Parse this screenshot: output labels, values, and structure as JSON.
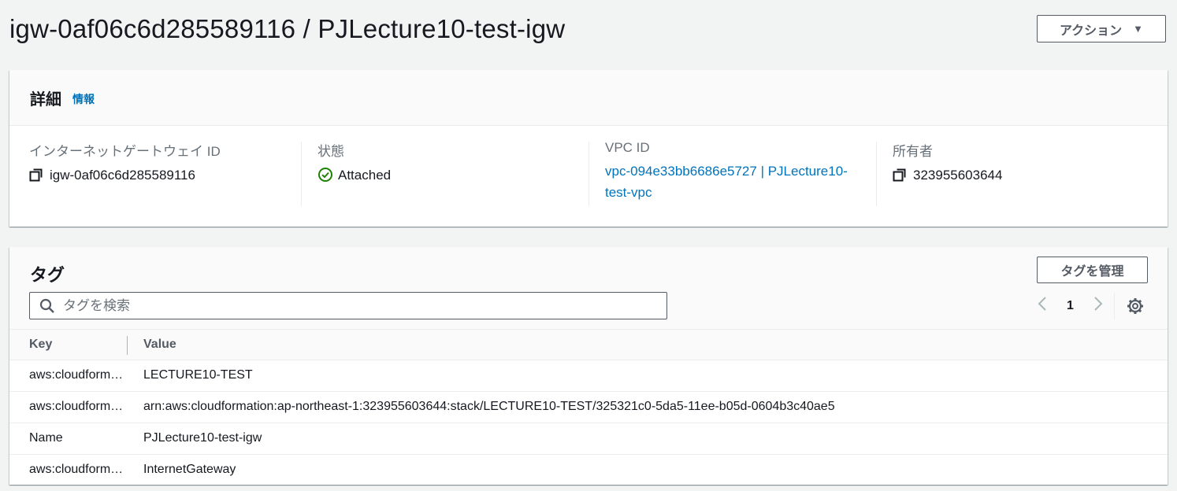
{
  "header": {
    "title": "igw-0af06c6d285589116 / PJLecture10-test-igw",
    "actions_label": "アクション"
  },
  "details": {
    "heading": "詳細",
    "info_link": "情報",
    "fields": {
      "igw_id_label": "インターネットゲートウェイ ID",
      "igw_id_value": "igw-0af06c6d285589116",
      "state_label": "状態",
      "state_value": "Attached",
      "vpc_label": "VPC ID",
      "vpc_value": "vpc-094e33bb6686e5727 | PJLecture10-test-vpc",
      "owner_label": "所有者",
      "owner_value": "323955603644"
    }
  },
  "tags": {
    "heading": "タグ",
    "manage_label": "タグを管理",
    "search_placeholder": "タグを検索",
    "page": "1",
    "columns": {
      "key": "Key",
      "value": "Value"
    },
    "rows": [
      {
        "key": "aws:cloudformation:stack-name",
        "value": "LECTURE10-TEST"
      },
      {
        "key": "aws:cloudformation:stack-id",
        "value": "arn:aws:cloudformation:ap-northeast-1:323955603644:stack/LECTURE10-TEST/325321c0-5da5-11ee-b05d-0604b3c40ae5"
      },
      {
        "key": "Name",
        "value": "PJLecture10-test-igw"
      },
      {
        "key": "aws:cloudformation:logical-id",
        "value": "InternetGateway"
      }
    ]
  },
  "colors": {
    "link": "#0073bb",
    "success": "#1d8102",
    "text": "#16191f",
    "secondary_text": "#687078"
  }
}
